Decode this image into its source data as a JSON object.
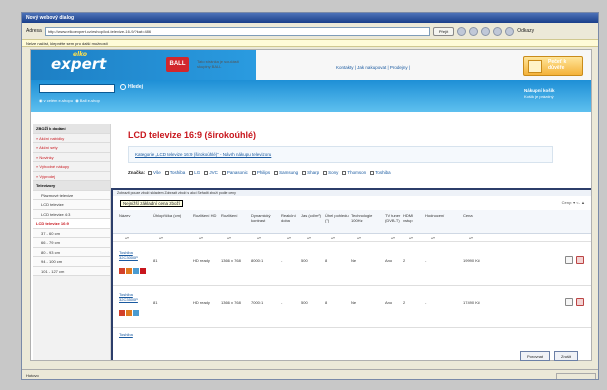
{
  "window": {
    "title": "Nový webový dialog"
  },
  "addressbar": {
    "label": "Adresa",
    "url": "http://www.elkoexpert.cz/eshop/lcd-televize-16-9/?kat=486",
    "go": "Přejít",
    "links": "Odkazy"
  },
  "infobar": {
    "text": "Nelze načíst, klepněte sem pro další možnosti"
  },
  "header": {
    "logo": "expert",
    "logo_small": "elko",
    "ball_badge": "BALL",
    "ball_text": "Tato stránka je součástí skupiny BALL",
    "toplinks": "Kontakty  |  Jak nakupovat  |  Prodejny  |",
    "pecat": "Pečeť k důvěře"
  },
  "search": {
    "button": "Hledej",
    "radio1": "v celém e-shopu",
    "radio2": "Ball e-shop",
    "cart_title": "Nákupní košík",
    "cart_sub": "Košík je prázdný"
  },
  "sidebar": {
    "items": [
      {
        "label": "ZBOŽÍ k dodání",
        "style": "head"
      },
      {
        "label": "» Akční nabídky",
        "style": "red"
      },
      {
        "label": "» Akční sety",
        "style": "red"
      },
      {
        "label": "» Novinky",
        "style": "red"
      },
      {
        "label": "» Výhodné nákupy",
        "style": "red"
      },
      {
        "label": "» Výprodej",
        "style": "red"
      },
      {
        "label": "Televizory",
        "style": "head"
      },
      {
        "label": "Plazmové televize",
        "style": "sub"
      },
      {
        "label": "LCD televize",
        "style": "sub"
      },
      {
        "label": "LCD televize 4:3",
        "style": "sub"
      },
      {
        "label": "LCD televize 16:9",
        "style": "active"
      },
      {
        "label": "37 - 60 cm",
        "style": "sub"
      },
      {
        "label": "66 - 79 cm",
        "style": "sub"
      },
      {
        "label": "80 - 93 cm",
        "style": "sub"
      },
      {
        "label": "94 - 100 cm",
        "style": "sub"
      },
      {
        "label": "101 - 127 cm",
        "style": "sub"
      }
    ]
  },
  "main": {
    "title": "LCD televize 16:9 (širokoúhlé)",
    "link": "Kategorie „LCD televize 16:9 (širokoúhlé)“ - Návrh nákupu televizoru",
    "brands_label": "Značka:",
    "brands": [
      "Vše",
      "Toshiba",
      "LG",
      "JVC",
      "Panasonic",
      "Philips",
      "Samsung",
      "Sharp",
      "Sony",
      "Thomson",
      "Toshiba"
    ]
  },
  "panel": {
    "filter_text": "Zobrazit pouze zboží skladem   Zobrazit zboží s akcí   Seřadit zboží podle ceny",
    "sort_text": "Ceny: ▾ &lt;- ▲",
    "tooltip": "Nejnižší základní cena zboží",
    "headers": [
      "Název",
      "Úhlopříčka (cm)",
      "Rozlišení HD",
      "Rozlišení",
      "Dynamický kontrast",
      "Reakční doba",
      "Jas (cd/m²)",
      "Úhel pohledu (°)",
      "Technologie 100Hz",
      "TV tuner (DVB-T)",
      "HDMI vstup",
      "Hodnocení",
      "Cena"
    ],
    "rows": [
      {
        "name": "Toshiba 32C3000P",
        "diag": "81",
        "hd": "HD ready",
        "res": "1366 x 768",
        "contrast": "8000:1",
        "response": "-",
        "bright": "500",
        "angle": "8",
        "hz100": "Ne",
        "dvbt": "Ano",
        "hdmi": "2",
        "rating": "-",
        "price": "19990 Kč"
      },
      {
        "name": "Toshiba 32C3500P",
        "diag": "81",
        "hd": "HD ready",
        "res": "1366 x 768",
        "contrast": "7000:1",
        "response": "-",
        "bright": "500",
        "angle": "8",
        "hz100": "Ne",
        "dvbt": "Ano",
        "hdmi": "2",
        "rating": "-",
        "price": "17490 Kč"
      }
    ],
    "next_name": "Toshiba"
  },
  "bottom": {
    "compare": "Porovnat",
    "reset": "Zrušit"
  },
  "status": {
    "text": "Hotovo"
  }
}
